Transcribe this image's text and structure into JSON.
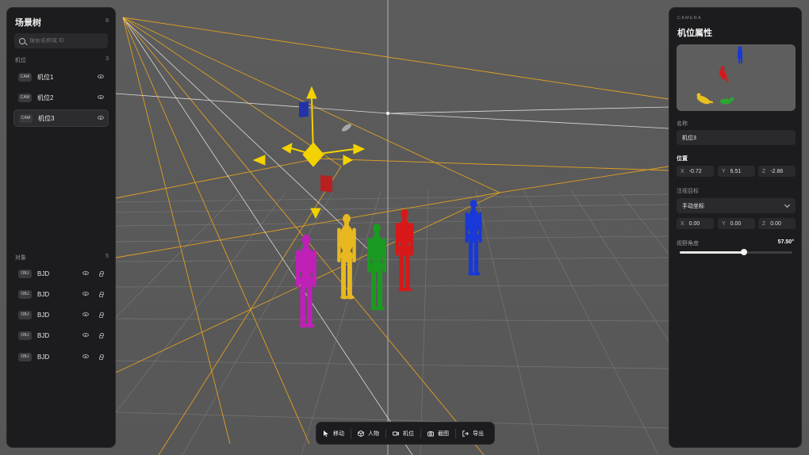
{
  "scene_tree": {
    "title": "场景树",
    "count": "8",
    "search_placeholder": "搜索名称或 ID",
    "cameras_section": {
      "label": "机位",
      "count": "3"
    },
    "cameras": [
      {
        "tag": "CAM",
        "label": "机位1"
      },
      {
        "tag": "CAM",
        "label": "机位2"
      },
      {
        "tag": "CAM",
        "label": "机位3",
        "selected": true
      }
    ],
    "objects_section": {
      "label": "对象",
      "count": "5"
    },
    "objects": [
      {
        "tag": "OBJ",
        "label": "BJD"
      },
      {
        "tag": "OBJ",
        "label": "BJD"
      },
      {
        "tag": "OBJ",
        "label": "BJD"
      },
      {
        "tag": "OBJ",
        "label": "BJD"
      },
      {
        "tag": "OBJ",
        "label": "BJD"
      }
    ]
  },
  "camera_panel": {
    "kicker": "CAMERA",
    "title": "机位属性",
    "name_label": "名称",
    "name_value": "机位3",
    "position_label": "位置",
    "position": {
      "x_label": "X",
      "x": "-0.72",
      "y_label": "Y",
      "y": "6.51",
      "z_label": "Z",
      "z": "-2.86"
    },
    "target_label": "注视目标",
    "target_mode": "手动坐标",
    "target": {
      "x_label": "X",
      "x": "0.00",
      "y_label": "Y",
      "y": "0.00",
      "z_label": "Z",
      "z": "0.00"
    },
    "fov_label": "视野角度",
    "fov_value": "57.50°",
    "fov_fraction": 0.57
  },
  "toolbar": {
    "items": [
      {
        "icon": "cursor-icon",
        "label": "移动"
      },
      {
        "icon": "person-cube-icon",
        "label": "人物"
      },
      {
        "icon": "video-camera-icon",
        "label": "机位"
      },
      {
        "icon": "camera-icon",
        "label": "截图"
      },
      {
        "icon": "export-icon",
        "label": "导出"
      }
    ]
  },
  "viewport": {
    "figures": [
      {
        "name": "magenta-figure",
        "color": "#c020b8"
      },
      {
        "name": "yellow-figure",
        "color": "#e8b820"
      },
      {
        "name": "green-figure",
        "color": "#1a9a20"
      },
      {
        "name": "red-figure",
        "color": "#d81818"
      },
      {
        "name": "blue-figure",
        "color": "#1838d8"
      }
    ],
    "gizmo_color": "#f2d200",
    "frustum_color": "#e0a020",
    "grid_color": "#7a7a7a",
    "background": "#5a5a5a"
  }
}
